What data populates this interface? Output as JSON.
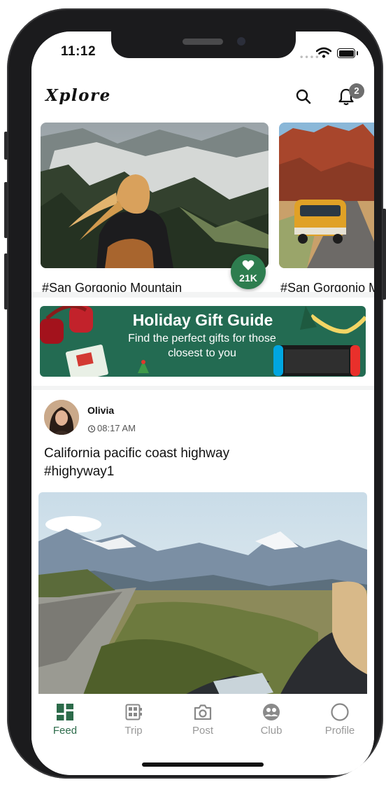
{
  "status_bar": {
    "time": "11:12"
  },
  "header": {
    "logo": "Xplore",
    "notification_count": "2"
  },
  "carousel": {
    "cards": [
      {
        "label": "#San Gorgonio Mountain",
        "likes": "21K"
      },
      {
        "label": "#San Gorgonio Mountain"
      }
    ]
  },
  "banner": {
    "title": "Holiday Gift Guide",
    "subtitle": "Find the perfect gifts for those closest to you"
  },
  "post": {
    "author": "Olivia",
    "time": "08:17 AM",
    "caption": "California pacific coast highway #highyway1"
  },
  "tabbar": {
    "items": [
      {
        "label": "Feed",
        "active": true
      },
      {
        "label": "Trip"
      },
      {
        "label": "Post"
      },
      {
        "label": "Club"
      },
      {
        "label": "Profile"
      }
    ]
  },
  "colors": {
    "accent": "#2c6b4a",
    "like_button": "#2e7d4f",
    "banner_bg": "#236b52",
    "inactive": "#999999"
  }
}
